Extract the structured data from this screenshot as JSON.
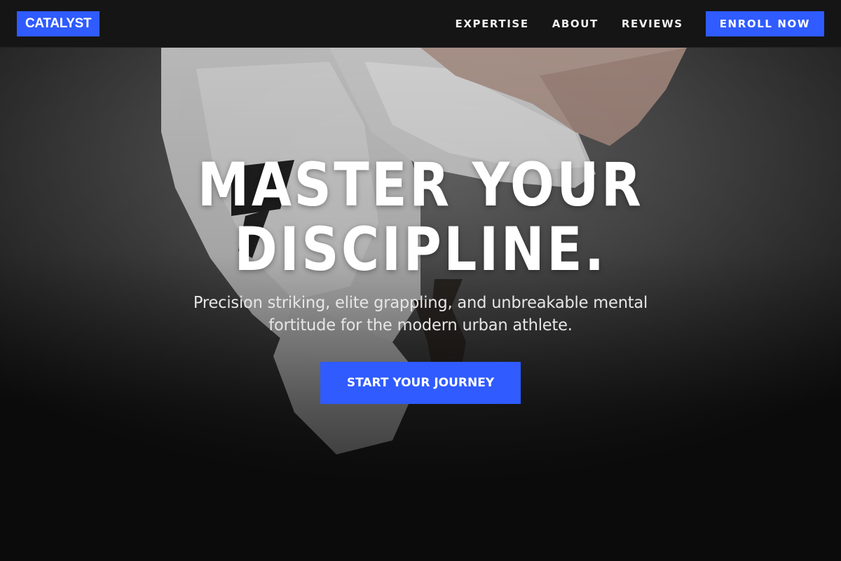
{
  "header": {
    "logo": "CATALYST",
    "nav": [
      {
        "label": "EXPERTISE"
      },
      {
        "label": "ABOUT"
      },
      {
        "label": "REVIEWS"
      }
    ],
    "cta_label": "ENROLL NOW"
  },
  "hero": {
    "headline_line1": "MASTER YOUR",
    "headline_line2": "DISCIPLINE.",
    "subtitle": "Precision striking, elite grappling, and unbreakable mental fortitude for the modern urban athlete.",
    "cta_label": "START YOUR JOURNEY",
    "background_image": "martial-artist-kick-photo"
  },
  "colors": {
    "accent": "#2f5bff",
    "navbar_bg": "#151515",
    "text": "#ffffff"
  }
}
